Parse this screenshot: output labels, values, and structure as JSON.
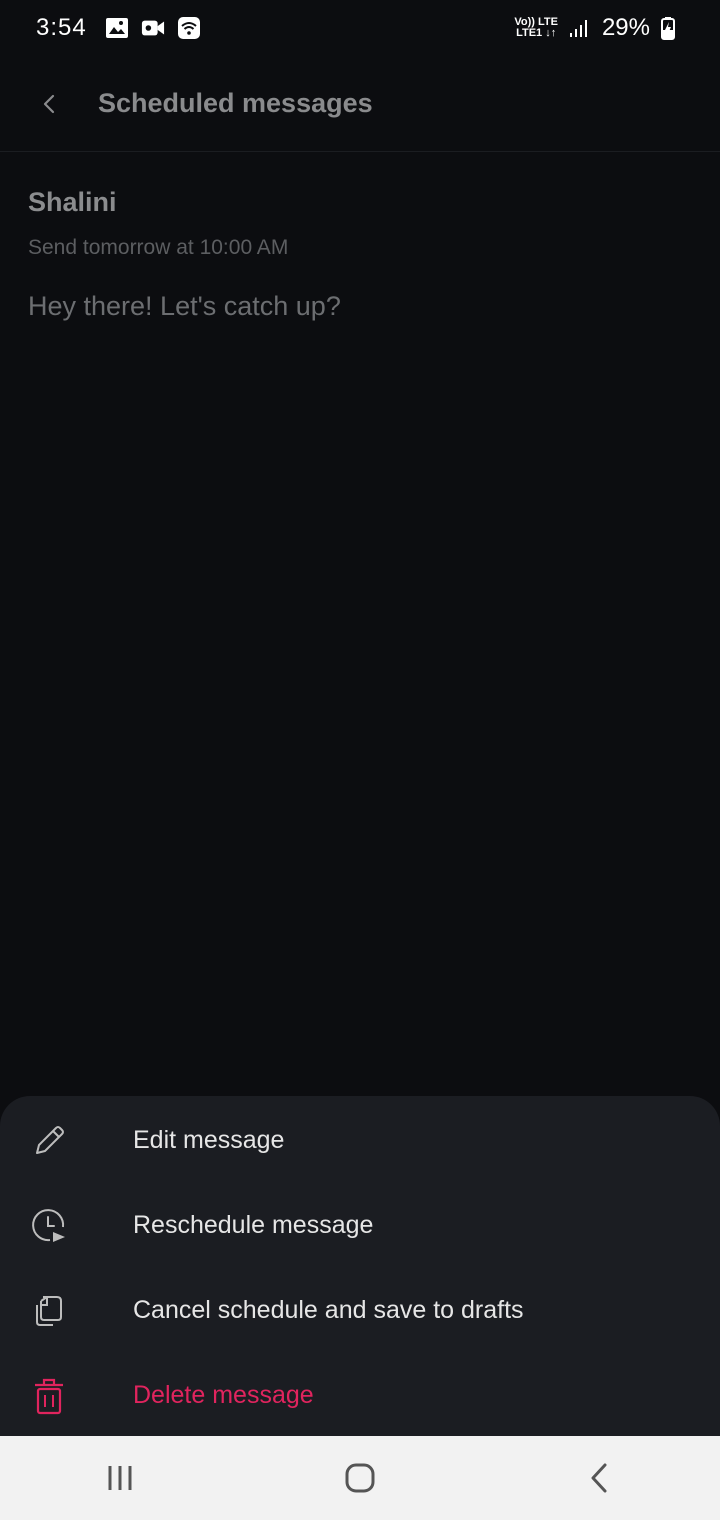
{
  "status_bar": {
    "time": "3:54",
    "network_top": "Vo)) LTE",
    "network_bottom": "LTE1 ↓↑",
    "battery": "29%",
    "icons": [
      "image-icon",
      "video-icon",
      "wifi-icon",
      "signal-icon",
      "battery-charging-icon"
    ]
  },
  "header": {
    "title": "Scheduled messages",
    "back_icon": "back-arrow-icon"
  },
  "message": {
    "recipient": "Shalini",
    "schedule": "Send tomorrow at 10:00 AM",
    "text": "Hey there! Let's catch up?"
  },
  "sheet": {
    "items": [
      {
        "label": "Edit message",
        "icon": "pencil-icon"
      },
      {
        "label": "Reschedule message",
        "icon": "clock-send-icon"
      },
      {
        "label": "Cancel schedule and save to drafts",
        "icon": "drafts-icon"
      },
      {
        "label": "Delete message",
        "icon": "trash-icon",
        "color": "#e0245e"
      }
    ]
  },
  "nav": {
    "icons": [
      "recents-icon",
      "home-icon",
      "back-icon"
    ]
  },
  "colors": {
    "background": "#0c0d10",
    "sheet": "#1b1d22",
    "danger": "#e0245e",
    "nav_bar": "#f2f2f2"
  }
}
